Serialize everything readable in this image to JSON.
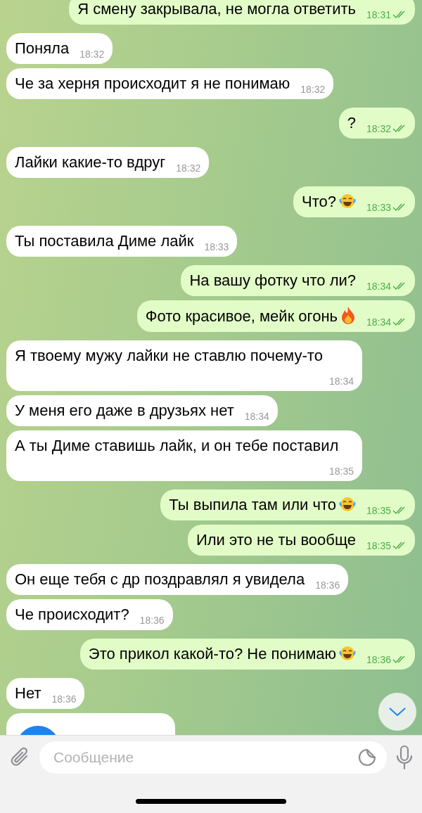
{
  "messages": [
    {
      "kind": "text",
      "outgoing": true,
      "text": "Я смену закрывала, не могла ответить",
      "time": "18:31",
      "read": true
    },
    {
      "kind": "text",
      "outgoing": false,
      "text": "Поняла",
      "time": "18:32"
    },
    {
      "kind": "text",
      "outgoing": false,
      "text": "Че за херня происходит я не понимаю",
      "time": "18:32"
    },
    {
      "kind": "text",
      "outgoing": true,
      "text": "?",
      "time": "18:32",
      "read": true
    },
    {
      "kind": "text",
      "outgoing": false,
      "text": "Лайки какие-то вдруг",
      "time": "18:32"
    },
    {
      "kind": "text",
      "outgoing": true,
      "text": "Что?",
      "trailing": {
        "kind": "laugh"
      },
      "time": "18:33",
      "read": true
    },
    {
      "kind": "text",
      "outgoing": false,
      "text": "Ты поставила Диме лайк",
      "time": "18:33"
    },
    {
      "kind": "text",
      "outgoing": true,
      "text": "На вашу фотку что ли?",
      "time": "18:34",
      "read": true
    },
    {
      "kind": "text",
      "outgoing": true,
      "text": "Фото красивое, мейк огонь",
      "trailing": {
        "kind": "fire"
      },
      "time": "18:34",
      "read": true
    },
    {
      "kind": "text",
      "outgoing": false,
      "text": "Я твоему мужу лайки не ставлю почему-то",
      "time": "18:34"
    },
    {
      "kind": "text",
      "outgoing": false,
      "text": "У меня его даже в друзьях нет",
      "time": "18:34"
    },
    {
      "kind": "text",
      "outgoing": false,
      "text": "А ты Диме ставишь лайк, и он тебе поставил",
      "time": "18:35"
    },
    {
      "kind": "text",
      "outgoing": true,
      "text": "Ты выпила там или что",
      "trailing": {
        "kind": "laugh"
      },
      "time": "18:35",
      "read": true
    },
    {
      "kind": "text",
      "outgoing": true,
      "text": "Или это не ты вообще",
      "time": "18:35",
      "read": true
    },
    {
      "kind": "text",
      "outgoing": false,
      "text": "Он еще тебя с др поздравлял я увидела",
      "time": "18:36"
    },
    {
      "kind": "text",
      "outgoing": false,
      "text": "Че происходит?",
      "time": "18:36"
    },
    {
      "kind": "text",
      "outgoing": true,
      "text": "Это прикол какой-то? Не понимаю",
      "trailing": {
        "kind": "laugh"
      },
      "time": "18:36",
      "read": true
    },
    {
      "kind": "text",
      "outgoing": false,
      "text": "Нет",
      "time": "18:36"
    },
    {
      "kind": "voice",
      "outgoing": false
    }
  ],
  "composer": {
    "placeholder": "Сообщение"
  }
}
